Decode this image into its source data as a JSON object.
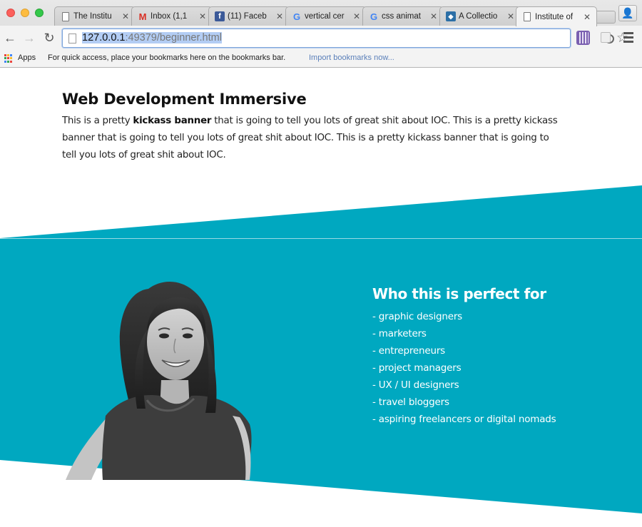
{
  "browser": {
    "tabs": [
      {
        "title": "The Institu",
        "favicon": "document-icon",
        "active": false
      },
      {
        "title": "Inbox (1,1",
        "favicon": "gmail-icon",
        "active": false
      },
      {
        "title": "(11) Faceb",
        "favicon": "facebook-icon",
        "active": false
      },
      {
        "title": "vertical cer",
        "favicon": "google-icon",
        "active": false
      },
      {
        "title": "css animat",
        "favicon": "google-icon",
        "active": false
      },
      {
        "title": "A Collectio",
        "favicon": "drop-icon",
        "active": false
      },
      {
        "title": "Institute of",
        "favicon": "document-icon",
        "active": true
      }
    ],
    "url_host": "127.0.0.1",
    "url_rest": ":49379/beginner.html",
    "bookmarks": {
      "apps_label": "Apps",
      "hint": "For quick access, place your bookmarks here on the bookmarks bar.",
      "import_link": "Import bookmarks now..."
    },
    "colors": {
      "accent": "#00a8c0",
      "selection": "#b3cdf4"
    }
  },
  "page": {
    "banner": {
      "title": "Web Development Immersive",
      "text_before": "This is a pretty ",
      "text_bold": "kickass banner",
      "text_after": " that is going to tell you lots of great shit about IOC. This is a pretty kickass banner that is going to tell you lots of great shit about IOC. This is a pretty kickass banner that is going to tell you lots of great shit about IOC."
    },
    "audience": {
      "title": "Who this is perfect for",
      "items": [
        "- graphic designers",
        "- marketers",
        "- entrepreneurs",
        "- project managers",
        "- UX / UI designers",
        "- travel bloggers",
        "- aspiring freelancers or digital nomads"
      ]
    },
    "colors": {
      "teal": "#00a8c0",
      "text": "#222222",
      "white": "#ffffff"
    }
  }
}
